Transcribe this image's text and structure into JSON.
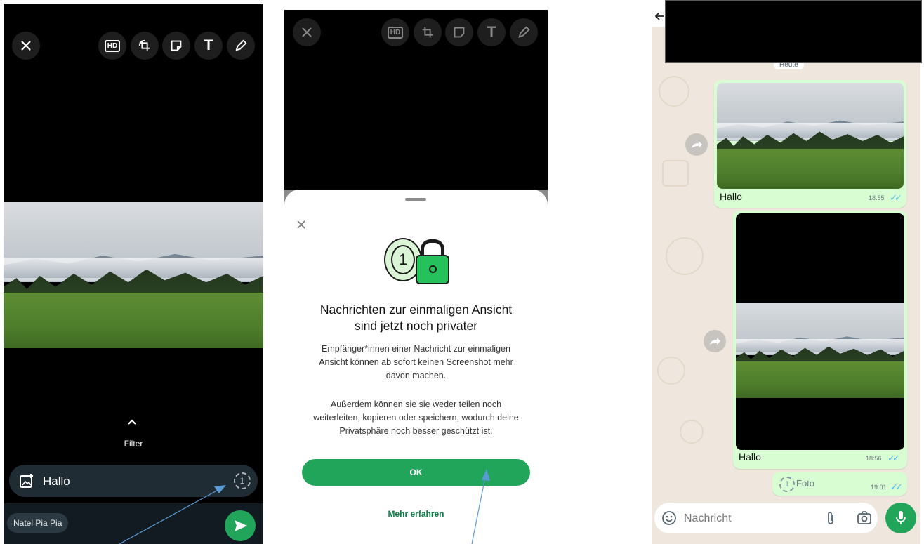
{
  "editor": {
    "toolbar": {
      "close_icon": "close-icon",
      "hd_label": "HD",
      "tools": [
        "crop-rotate-icon",
        "sticker-icon",
        "text-icon",
        "pencil-icon"
      ],
      "text_tool_label": "T"
    },
    "filter_label": "Filter",
    "caption": {
      "value": "Hallo",
      "view_once_label": "1"
    },
    "recipient": "Natel Pia Pia"
  },
  "dialog": {
    "title_line1": "Nachrichten zur einmaligen Ansicht",
    "title_line2": "sind jetzt noch privater",
    "para1_line1": "Empfänger*innen einer Nachricht zur einmaligen",
    "para1_line2": "Ansicht können ab sofort keinen Screenshot mehr",
    "para1_line3": "davon machen.",
    "para2_line1": "Außerdem können sie sie weder teilen noch",
    "para2_line2": "weiterleiten, kopieren oder speichern, wodurch deine",
    "para2_line3": "Privatsphäre noch besser geschützt ist.",
    "ok_label": "OK",
    "learn_more_label": "Mehr erfahren",
    "hd_label": "HD",
    "badge_label": "1",
    "accent": "#21a55b"
  },
  "chat": {
    "date_chip": "Heute",
    "messages": [
      {
        "caption": "Hallo",
        "time": "18:55"
      },
      {
        "caption": "Hallo",
        "time": "18:56"
      },
      {
        "view_once_label": "Foto",
        "time": "19:01"
      }
    ],
    "input_placeholder": "Nachricht",
    "view_once_number": "1",
    "colors": {
      "bubble": "#d9fdd3",
      "wallpaper": "#efe7dd",
      "tick": "#53bdeb",
      "mic": "#21a55b"
    }
  }
}
